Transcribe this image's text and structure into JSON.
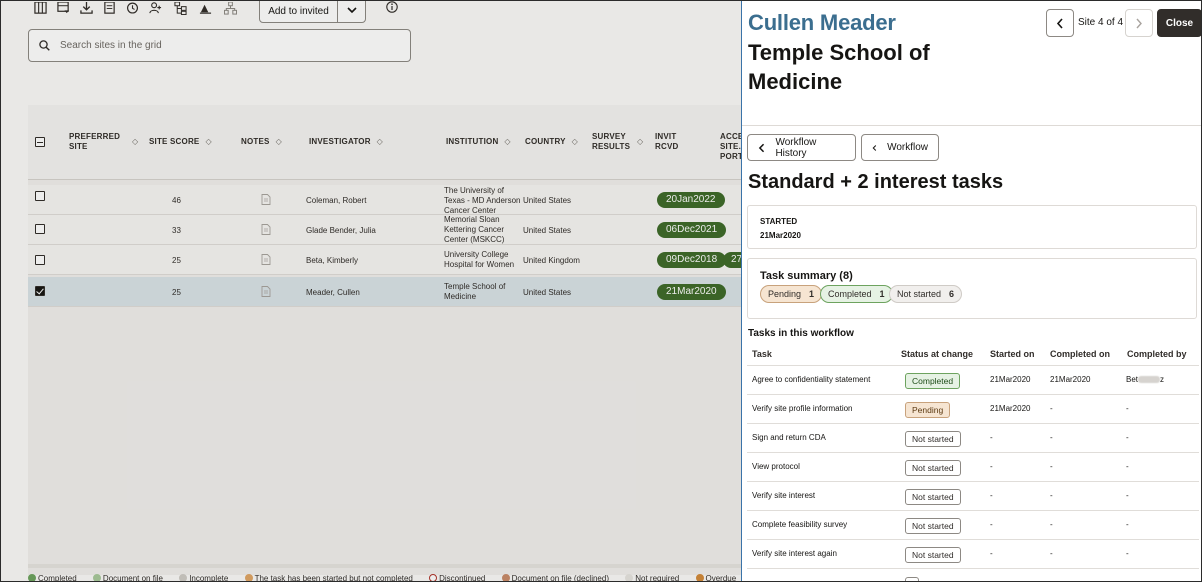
{
  "toolbar": {
    "icons": [
      "columns-icon",
      "filter-table-icon",
      "download-icon",
      "notes-icon",
      "clock-icon",
      "person-add-icon",
      "hierarchy-icon",
      "chart-icon",
      "org-icon"
    ],
    "add_invited_label": "Add to invited"
  },
  "search": {
    "placeholder": "Search sites in the grid"
  },
  "grid": {
    "columns": {
      "preferred_site": "PREFERRED SITE",
      "site_score": "SITE SCORE",
      "notes": "NOTES",
      "investigator": "INVESTIGATOR",
      "institution": "INSTITUTION",
      "country": "COUNTRY",
      "survey_results": "SURVEY RESULTS",
      "invit_rcvd": "INVIT RCVD",
      "acce_site_port": "ACCE SITE. PORT"
    },
    "rows": [
      {
        "score": "46",
        "investigator": "Coleman, Robert",
        "institution": "The University of Texas - MD Anderson Cancer Center",
        "country": "United States",
        "date": "20Jan2022",
        "extra": ""
      },
      {
        "score": "33",
        "investigator": "Glade Bender, Julia",
        "institution": "Memorial Sloan Kettering Cancer Center (MSKCC)",
        "country": "United States",
        "date": "06Dec2021",
        "extra": ""
      },
      {
        "score": "25",
        "investigator": "Beta, Kimberly",
        "institution": "University College Hospital for Women",
        "country": "United Kingdom",
        "date": "09Dec2018",
        "extra": "27"
      },
      {
        "score": "25",
        "investigator": "Meader, Cullen",
        "institution": "Temple School of Medicine",
        "country": "United States",
        "date": "21Mar2020",
        "extra": ""
      }
    ]
  },
  "legend": {
    "items": [
      "Completed",
      "Document on file",
      "Incomplete",
      "The task has been started but not completed",
      "Discontinued",
      "Document on file (declined)",
      "Not required",
      "Overdue"
    ]
  },
  "drawer": {
    "investigator_name": "Cullen Meader",
    "institution_title": "Temple School of Medicine",
    "site_counter": "Site 4 of 4",
    "close_label": "Close",
    "workflow_history_label": "Workflow History",
    "workflow_label": "Workflow",
    "workflow_title": "Standard + 2 interest tasks",
    "started_label": "STARTED",
    "started_value": "21Mar2020",
    "task_summary_title": "Task summary (8)",
    "summary": {
      "pending_label": "Pending",
      "pending_count": "1",
      "completed_label": "Completed",
      "completed_count": "1",
      "not_started_label": "Not started",
      "not_started_count": "6"
    },
    "tasks_title": "Tasks in this workflow",
    "task_columns": {
      "task": "Task",
      "status": "Status at change",
      "started": "Started on",
      "completed": "Completed on",
      "completed_by": "Completed by"
    },
    "tasks": [
      {
        "task": "Agree to confidentiality statement",
        "status": "Completed",
        "status_key": "completed",
        "started": "21Mar2020",
        "completed": "21Mar2020",
        "by": "Bet"
      },
      {
        "task": "Verify site profile information",
        "status": "Pending",
        "status_key": "pending",
        "started": "21Mar2020",
        "completed": "-",
        "by": "-"
      },
      {
        "task": "Sign and return CDA",
        "status": "Not started",
        "status_key": "notstarted",
        "started": "-",
        "completed": "-",
        "by": "-"
      },
      {
        "task": "View protocol",
        "status": "Not started",
        "status_key": "notstarted",
        "started": "-",
        "completed": "-",
        "by": "-"
      },
      {
        "task": "Verify site interest",
        "status": "Not started",
        "status_key": "notstarted",
        "started": "-",
        "completed": "-",
        "by": "-"
      },
      {
        "task": "Complete feasibility survey",
        "status": "Not started",
        "status_key": "notstarted",
        "started": "-",
        "completed": "-",
        "by": "-"
      },
      {
        "task": "Verify site interest again",
        "status": "Not started",
        "status_key": "notstarted",
        "started": "-",
        "completed": "-",
        "by": "-"
      }
    ]
  },
  "colors": {
    "name_blue": "#3b6e8f",
    "date_pill_green": "#3e6b2a",
    "close_dark": "#312d2a",
    "selected_row": "#d9e3e8"
  }
}
